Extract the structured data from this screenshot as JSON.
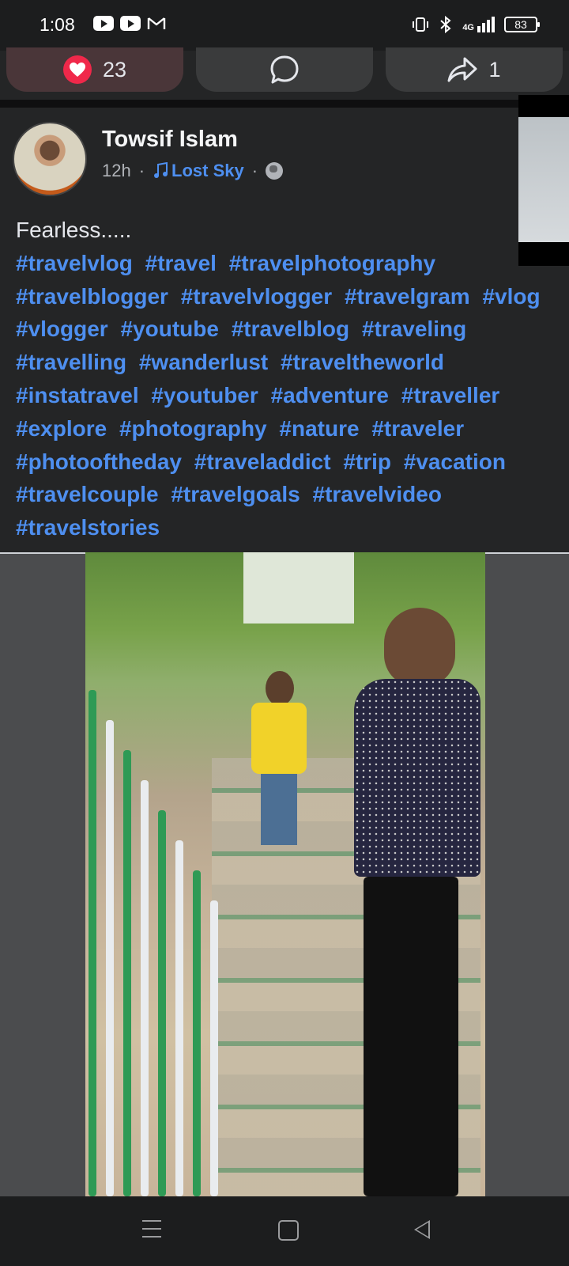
{
  "status_bar": {
    "time": "1:08",
    "left_icons": [
      "youtube-icon",
      "youtube-icon",
      "gmail-icon"
    ],
    "right_icons": [
      "vibrate-icon",
      "bluetooth-icon",
      "signal-4g-icon"
    ],
    "network": "4G",
    "battery": "83"
  },
  "reactions": {
    "like_count": "23",
    "share_count": "1",
    "icons": [
      "heart-icon",
      "comment-icon",
      "share-icon"
    ]
  },
  "post": {
    "author": "Towsif Islam",
    "time": "12h",
    "separator": "·",
    "music": "Lost Sky",
    "privacy_icon": "globe-icon",
    "caption_text": "Fearless.....",
    "hashtags": [
      "#travelvlog",
      "#travel",
      "#travelphotography",
      "#travelblogger",
      "#travelvlogger",
      "#travelgram",
      "#vlog",
      "#vlogger",
      "#youtube",
      "#travelblog",
      "#traveling",
      "#travelling",
      "#wanderlust",
      "#traveltheworld",
      "#instatravel",
      "#youtuber",
      "#adventure",
      "#traveller",
      "#explore",
      "#photography",
      "#nature",
      "#traveler",
      "#photooftheday",
      "#traveladdict",
      "#trip",
      "#vacation",
      "#travelcouple",
      "#travelgoals",
      "#travelvideo",
      "#travelstories"
    ]
  },
  "colors": {
    "background": "#242526",
    "link": "#4e8ff0",
    "heart": "#f0284a"
  },
  "navbar": {
    "icons": [
      "menu-icon",
      "home-icon",
      "back-icon"
    ]
  }
}
